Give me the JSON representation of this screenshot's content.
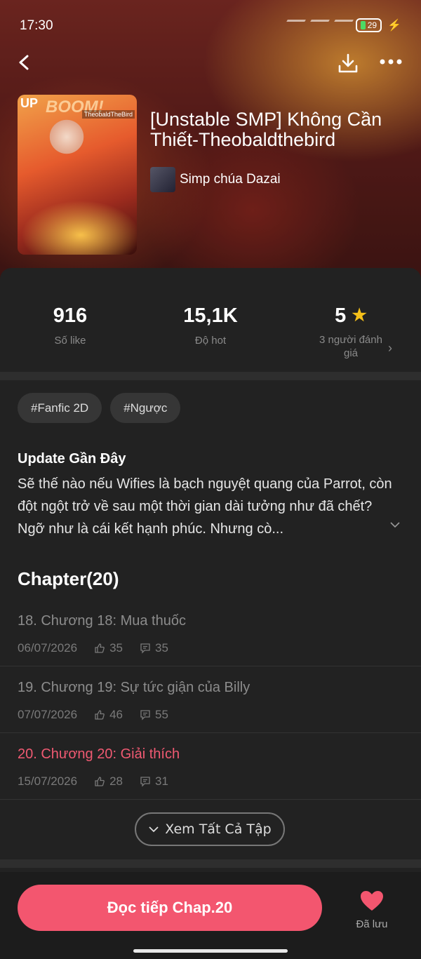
{
  "status_bar": {
    "time": "17:30",
    "battery": "29"
  },
  "book": {
    "cover_badge": "UP",
    "cover_text": "BOOM!",
    "cover_watermark": "TheobaldTheBird",
    "title": "[Unstable SMP] Không Cần Thiết-Theobaldthebird",
    "author": "Simp chúa Dazai"
  },
  "stats": {
    "likes_value": "916",
    "likes_label": "Số like",
    "hot_value": "15,1K",
    "hot_label": "Độ hot",
    "rating_value": "5",
    "rating_label": "3 người đánh giá"
  },
  "tags": [
    "#Fanfic 2D",
    "#Ngược"
  ],
  "update": {
    "heading": "Update Gần Đây",
    "text": "Sẽ thế nào nếu Wifies là bạch nguyệt quang của Parrot, còn đột ngột trở về sau một thời gian dài tưởng như đã chết? Ngỡ như là cái kết hạnh phúc. Nhưng cò..."
  },
  "chapters": {
    "heading": "Chapter(20)",
    "items": [
      {
        "title": "18. Chương 18: Mua thuốc",
        "date": "06/07/2026",
        "likes": "35",
        "comments": "35"
      },
      {
        "title": "19. Chương 19: Sự tức giận của Billy",
        "date": "07/07/2026",
        "likes": "46",
        "comments": "55"
      },
      {
        "title": "20. Chương 20: Giải thích",
        "date": "15/07/2026",
        "likes": "28",
        "comments": "31"
      }
    ],
    "view_all_label": "Xem Tất Cả Tập"
  },
  "bottom": {
    "read_label": "Đọc tiếp Chap.20",
    "saved_label": "Đã lưu"
  },
  "colors": {
    "accent": "#f3566f",
    "active_chapter": "#f05a72",
    "star": "#f5c019",
    "sheet_bg": "#222222"
  },
  "icons": [
    "back-arrow-icon",
    "download-icon",
    "more-dots-icon",
    "star-icon",
    "chevron-right-icon",
    "chevron-down-icon",
    "thumb-up-icon",
    "comment-icon",
    "heart-icon"
  ]
}
